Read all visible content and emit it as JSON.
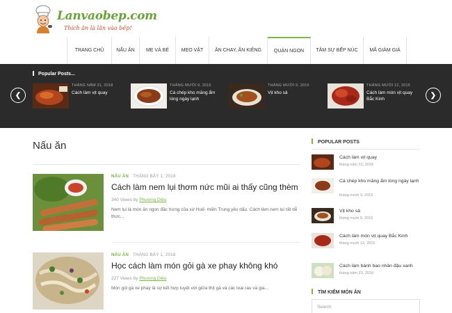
{
  "header": {
    "logo_title": "Lanvaobep.com",
    "logo_tagline": "Thích ăn là lăn vào bếp!"
  },
  "nav": {
    "items": [
      "TRANG CHỦ",
      "NẤU ĂN",
      "MẸ VÀ BÉ",
      "MẸO VẶT",
      "ĂN CHAY, ĂN KIÊNG",
      "QUÁN NGON",
      "TÂM SỰ BẾP NÚC",
      "MÃ GIẢM GIÁ"
    ],
    "active": "QUÁN NGON"
  },
  "slider": {
    "title": "Popular Posts...",
    "prev_icon": "chevron-left-icon",
    "next_icon": "chevron-right-icon",
    "slides": [
      {
        "date": "THÁNG NĂM 31, 2018",
        "title": "Cách làm vịt quay"
      },
      {
        "date": "THÁNG MƯỜI 9, 2015",
        "title": "Cá chép kho măng ẩm lòng ngày lạnh"
      },
      {
        "date": "THÁNG MƯỜI 9, 2015",
        "title": "Vịt kho sả"
      },
      {
        "date": "THÁNG MƯỜI 12, 2015",
        "title": "Cách làm món vịt quay Bắc Kinh"
      }
    ]
  },
  "main": {
    "heading": "Nấu ăn",
    "posts": [
      {
        "category": "NẤU ĂN",
        "date": "THÁNG BẢY 1, 2018",
        "title": "Cách làm nem lụi thơm nức mũi ai thấy cũng thèm",
        "views": "340 Views",
        "by": "by",
        "author": "Phương Diệu",
        "excerpt": "Nem lụi là món ăn ngon đặc trưng của xứ Huế- miền Trung yêu dấu. Cách làm nem lụi rất dễ thực..."
      },
      {
        "category": "NẤU ĂN",
        "date": "THÁNG BẢY 1, 2018",
        "title": "Học cách làm món gỏi gà xe phay không khó",
        "views": "227 Views",
        "by": "by",
        "author": "Phương Diệu",
        "excerpt": "Món gỏi gà xe phay là sự kết hợp tuyệt vời giữa thịt gà và các loại rau và gia..."
      }
    ]
  },
  "sidebar": {
    "popular_heading": "POPULAR POSTS",
    "posts": [
      {
        "title": "Cách làm vịt quay",
        "date": "tháng năm 31, 2018"
      },
      {
        "title": "Cá chép kho măng ẩm lòng ngày lạnh",
        "date": "tháng mười 9, 2015"
      },
      {
        "title": "Vịt kho sả",
        "date": "tháng mười 9, 2015"
      },
      {
        "title": "Cách làm món vịt quay Bắc Kinh",
        "date": "tháng mười 12, 2015"
      },
      {
        "title": "Cách làm bánh bao nhân đậu xanh",
        "date": "tháng năm 23, 2018"
      }
    ],
    "search_heading": "TÌM KIẾM MÓN ĂN",
    "search_placeholder": "Search"
  },
  "colors": {
    "accent": "#7cb342",
    "dark_band": "#2b2b2b",
    "logo_green": "#6aa33a",
    "tagline_red": "#c94a2b"
  }
}
